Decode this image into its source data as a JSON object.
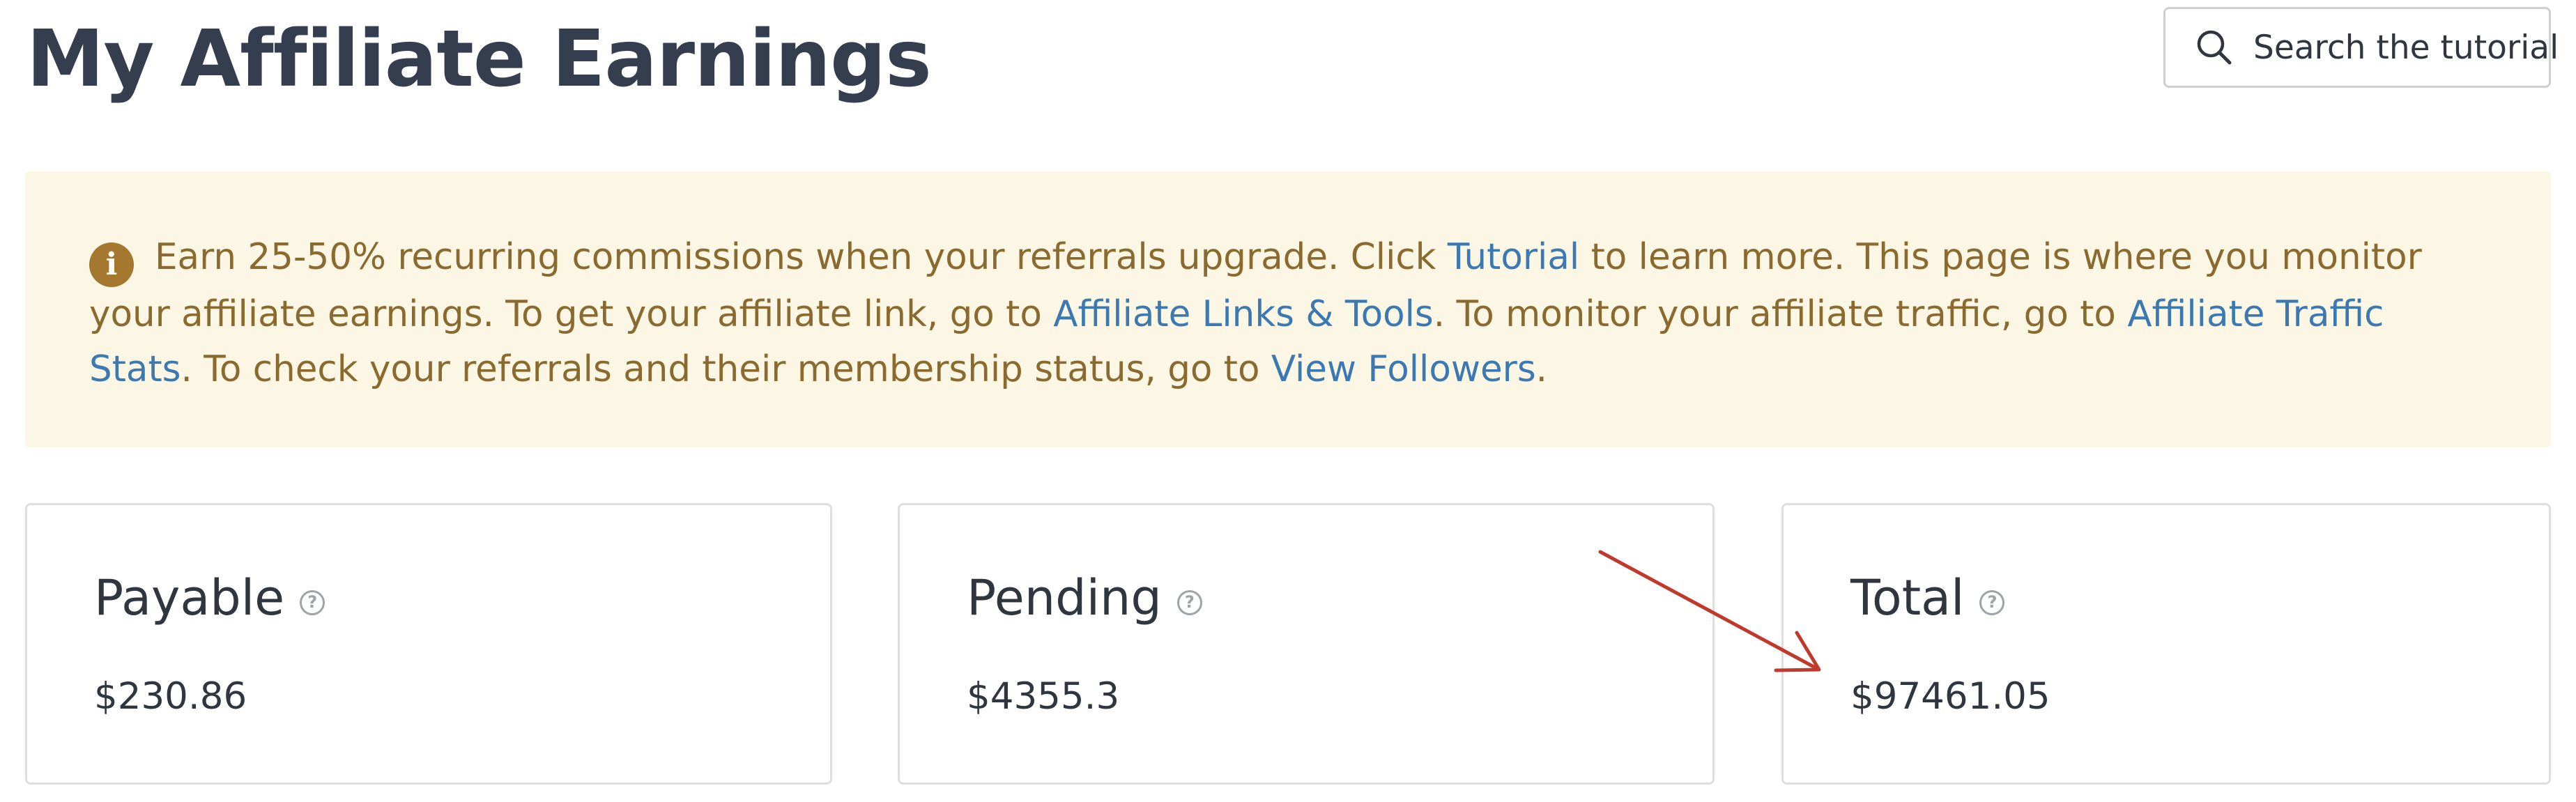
{
  "page": {
    "title": "My Affiliate Earnings"
  },
  "search": {
    "label": "Search the tutorial",
    "icon": "search-icon"
  },
  "notice": {
    "icon": "info-icon",
    "text_1": "Earn 25-50% recurring commissions when your referrals upgrade. Click ",
    "link_tutorial": "Tutorial",
    "text_2": " to learn more. This page is where you monitor your affiliate earnings. To get your affiliate link, go to ",
    "link_affiliate_links": "Affiliate Links & Tools",
    "text_3": ". To monitor your affiliate traffic, go to ",
    "link_traffic_stats": "Affiliate Traffic Stats",
    "text_4": ". To check your referrals and their membership status, go to ",
    "link_view_followers": "View Followers",
    "text_5": ".",
    "background_color": "#fcf7e4",
    "text_color": "#8a6a2f",
    "link_color": "#3c78b2"
  },
  "cards": [
    {
      "heading": "Payable",
      "help_icon": "question-circle-icon",
      "help_glyph": "?",
      "value": "$230.86"
    },
    {
      "heading": "Pending",
      "help_icon": "question-circle-icon",
      "help_glyph": "?",
      "value": "$4355.3"
    },
    {
      "heading": "Total",
      "help_icon": "question-circle-icon",
      "help_glyph": "?",
      "value": "$97461.05"
    }
  ],
  "annotation": {
    "arrow_color": "#c0392b",
    "points_to": "Total"
  },
  "info_glyph": "i"
}
